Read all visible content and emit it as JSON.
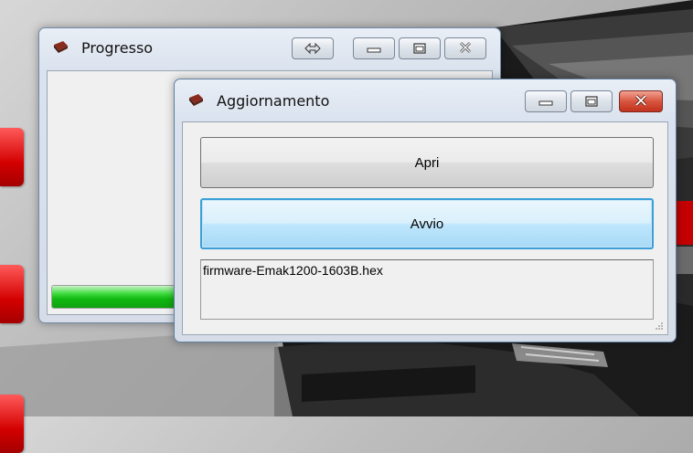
{
  "windows": {
    "progress": {
      "title": "Progresso",
      "progress_fraction": 0.95
    },
    "update": {
      "title": "Aggiornamento",
      "open_button_label": "Apri",
      "start_button_label": "Avvio",
      "output_text": "firmware-Emak1200-1603B.hex"
    }
  },
  "icons": {
    "app": "card-reader-icon",
    "resize": "double-arrow-icon",
    "minimize": "minimize-icon",
    "maximize": "maximize-icon",
    "close": "close-icon"
  },
  "colors": {
    "progress_fill": "#22c728",
    "close_button": "#c9412b",
    "focus_border": "#3c9fd8",
    "side_tabs": "#d90000"
  }
}
